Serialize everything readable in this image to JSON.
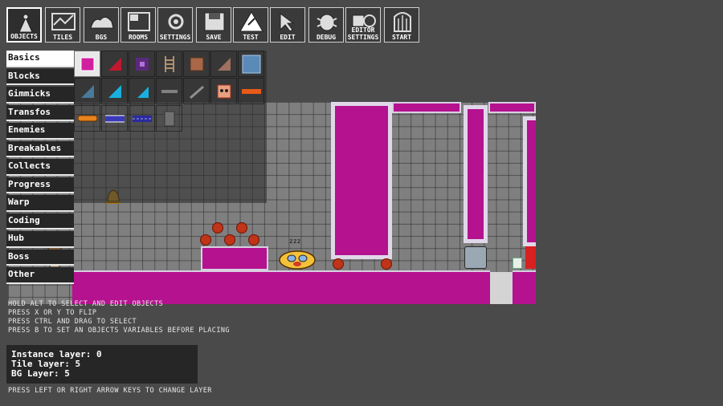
{
  "toolbar": [
    {
      "label": "OBJECTS",
      "icon": "objects-icon",
      "active": true
    },
    {
      "label": "TILES",
      "icon": "tiles-icon"
    },
    {
      "label": "BGS",
      "icon": "bgs-icon"
    },
    {
      "label": "ROOMS",
      "icon": "rooms-icon"
    },
    {
      "label": "SETTINGS",
      "icon": "settings-icon"
    },
    {
      "label": "SAVE",
      "icon": "save-icon"
    },
    {
      "label": "TEST",
      "icon": "test-icon"
    },
    {
      "label": "EDIT",
      "icon": "edit-icon"
    },
    {
      "label": "DEBUG",
      "icon": "debug-icon"
    },
    {
      "label": "EDITOR\nSETTINGS",
      "icon": "editor-settings-icon"
    },
    {
      "label": "START",
      "icon": "start-icon"
    }
  ],
  "categories": [
    "Basics",
    "Blocks",
    "Gimmicks",
    "Transfos",
    "Enemies",
    "Breakables",
    "Collects",
    "Progress",
    "Warp",
    "Coding",
    "Hub",
    "Boss",
    "Other"
  ],
  "selected_category": "Basics",
  "objects": [
    "pink-solid-block-icon",
    "red-slope-icon",
    "purple-lock-block-icon",
    "ladder-icon",
    "destructible-block-icon",
    "brown-slope-icon",
    "blue-glass-block-icon",
    "grey-slope-icon",
    "cyan-slope-icon",
    "cyan-slope-small-icon",
    "grey-platform-icon",
    "grey-diagonal-platform-icon",
    "face-block-icon",
    "orange-platform-icon",
    "orange-spring-icon",
    "blue-conveyor-icon",
    "blue-conveyor-arrows-icon",
    "grey-door-icon"
  ],
  "hints": [
    "HOLD ALT TO SELECT AND EDIT OBJECTS",
    "PRESS X OR Y TO FLIP",
    "PRESS CTRL AND DRAG TO SELECT",
    "PRESS B TO SET AN OBJECTS VARIABLES BEFORE PLACING"
  ],
  "layers": {
    "instance": "Instance layer: 0",
    "tile": "Tile layer: 5",
    "bg": "BG Layer: 5"
  },
  "layer_hint": "PRESS LEFT OR RIGHT ARROW KEYS TO CHANGE LAYER",
  "colors": {
    "solid": "#b4128f",
    "panel": "#262626",
    "background": "#4a4a4a"
  }
}
